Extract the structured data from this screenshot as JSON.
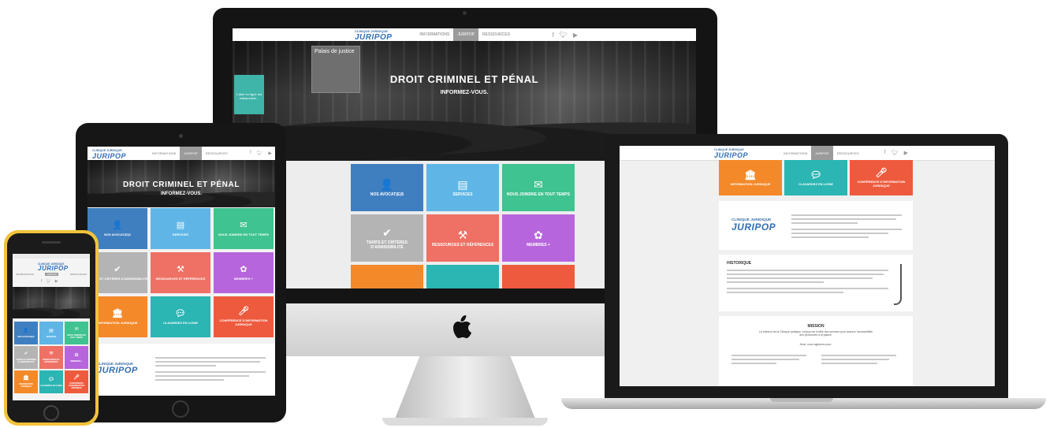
{
  "site": {
    "logo_top": "CLINIQUE JURIDIQUE",
    "logo": "JURIPOP",
    "nav": [
      "INFORMATIONS",
      "JURIPOP",
      "RESSOURCES"
    ],
    "social_icons": [
      "facebook-icon",
      "twitter-icon",
      "youtube-icon"
    ],
    "hero_title": "DROIT CRIMINEL ET PÉNAL",
    "hero_subtitle": "INFORMEZ-VOUS.",
    "building_sign": "Palais de justice",
    "chat_badge": "L'aide en ligne est indisponible...",
    "tiles": [
      {
        "label": "NOS AVOCAT(E)S",
        "icon": "lawyer-icon",
        "color": "#3f7fc0"
      },
      {
        "label": "SERVICES",
        "icon": "document-icon",
        "color": "#5fb6e6"
      },
      {
        "label": "NOUS JOINDRE EN TOUT TEMPS",
        "icon": "envelope-icon",
        "color": "#3fc390"
      },
      {
        "label": "TARIFS ET CRITÈRES D'ADMISSIBILITÉ",
        "icon": "check-icon",
        "color": "#b4b4b4"
      },
      {
        "label": "RESSOURCES ET RÉFÉRENCES",
        "icon": "gavel-icon",
        "color": "#ef7064"
      },
      {
        "label": "MEMBRES +",
        "icon": "members-icon",
        "color": "#b765dd"
      },
      {
        "label": "INFORMATION JURIDIQUE",
        "icon": "courthouse-icon",
        "color": "#f4892a"
      },
      {
        "label": "CLAVARDEZ EN LIGNE",
        "icon": "chat-icon",
        "color": "#2bb5b3"
      },
      {
        "label": "CONFÉRENCE D'INFORMATION JURIDIQUE",
        "icon": "microphone-icon",
        "color": "#ee5a3d"
      }
    ],
    "historique_title": "HISTORIQUE",
    "mission_title": "MISSION",
    "mission_text": "La mission de la Clinique juridique Juripop est d'offrir des services pour assurer l'accessibilité des personnes à la justice.",
    "mission_sub": "Ainsi, nous agissons pour:"
  },
  "colors": {
    "accent_blue": "#3f7fc0",
    "phone_frame": "#f2c23a",
    "device_black": "#1c1c1c"
  }
}
